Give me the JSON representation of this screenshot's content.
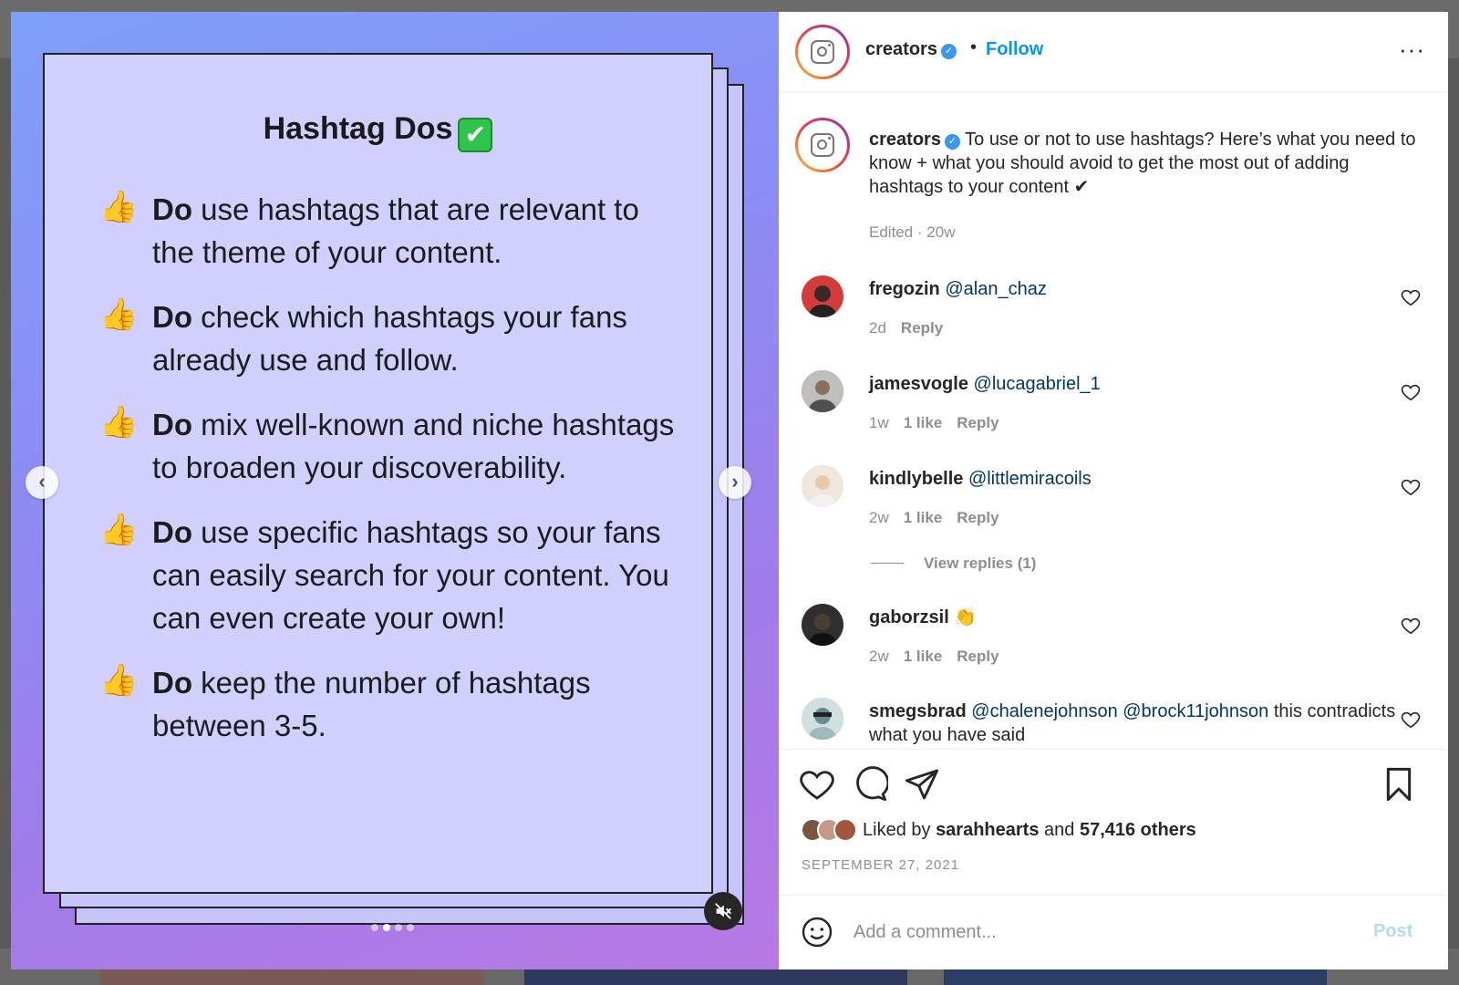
{
  "background_strip": {
    "tiles": [
      {
        "color": "#7a5a55"
      },
      {
        "color": "#2d3a5e"
      },
      {
        "color": "#2a3f66"
      }
    ]
  },
  "media": {
    "card": {
      "title": "Hashtag Dos",
      "title_emoji": "✔",
      "items": [
        {
          "lead": "Do",
          "text": " use hashtags that are relevant to the theme of your content."
        },
        {
          "lead": "Do",
          "text": " check which hashtags your fans already use and follow."
        },
        {
          "lead": "Do",
          "text": " mix well-known and niche hashtags to broaden your discoverability."
        },
        {
          "lead": "Do",
          "text": " use specific hashtags so your fans can easily search for your content. You can even create your own!"
        },
        {
          "lead": "Do",
          "text": " keep the number of hashtags between 3-5."
        }
      ]
    },
    "prev_icon": "chevron-left-icon",
    "next_icon": "chevron-right-icon",
    "mute_icon": "speaker-muted-icon",
    "carousel": {
      "count": 4,
      "active_index": 1
    }
  },
  "header": {
    "username": "creators",
    "separator": "•",
    "follow_label": "Follow",
    "more_label": "···"
  },
  "caption": {
    "username": "creators",
    "text": " To use or not to use hashtags? Here’s what you need to know + what you should avoid to get the most out of adding hashtags to your content ✔",
    "meta": "Edited · 20w"
  },
  "comments": [
    {
      "username": "fregozin",
      "mentions": "@alan_chaz",
      "text": "",
      "time": "2d",
      "likes": "",
      "reply": "Reply",
      "avatar_color": "#d63b3b"
    },
    {
      "username": "jamesvogle",
      "mentions": "@lucagabriel_1",
      "text": "",
      "time": "1w",
      "likes": "1 like",
      "reply": "Reply",
      "avatar_color": "#7d7f7a"
    },
    {
      "username": "kindlybelle",
      "mentions": "@littlemiracoils",
      "text": "",
      "time": "2w",
      "likes": "1 like",
      "reply": "Reply",
      "avatar_color": "#d9c8bb"
    },
    {
      "username": "gaborzsil",
      "mentions": "",
      "text": " 👏",
      "time": "2w",
      "likes": "1 like",
      "reply": "Reply",
      "avatar_color": "#2f2f2f"
    },
    {
      "username": "smegsbrad",
      "mentions": "@chalenejohnson @brock11johnson",
      "text": " this contradicts what you have said",
      "time": "",
      "likes": "",
      "reply": "",
      "avatar_color": "#7aa3a8"
    }
  ],
  "view_replies": "View replies (1)",
  "actions": {
    "like_icon": "heart-icon",
    "comment_icon": "comment-bubble-icon",
    "share_icon": "paper-plane-icon",
    "save_icon": "bookmark-icon"
  },
  "likes": {
    "prefix": "Liked by ",
    "user": "sarahhearts",
    "middle": " and ",
    "count": "57,416 others"
  },
  "post_date": "SEPTEMBER 27, 2021",
  "add_comment": {
    "placeholder": "Add a comment...",
    "post_label": "Post"
  },
  "colors": {
    "accent": "#0095f6",
    "post_disabled": "#b3dbff",
    "mention": "#00376b",
    "muted": "#8e8e8e"
  }
}
